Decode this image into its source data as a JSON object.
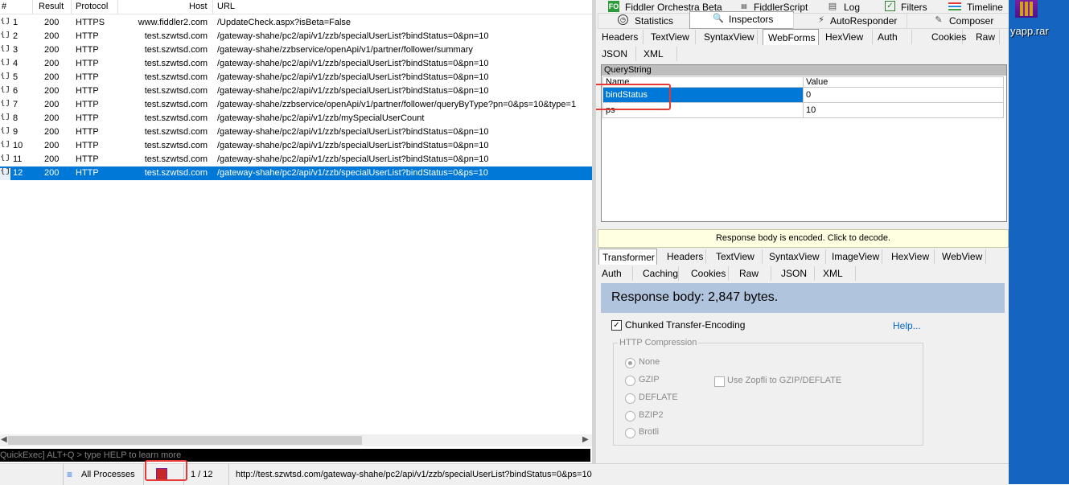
{
  "sessions": {
    "columns": {
      "num": "#",
      "result": "Result",
      "protocol": "Protocol",
      "host": "Host",
      "url": "URL"
    },
    "rows": [
      {
        "num": "1",
        "result": "200",
        "protocol": "HTTPS",
        "host": "www.fiddler2.com",
        "url": "/UpdateCheck.aspx?isBeta=False"
      },
      {
        "num": "2",
        "result": "200",
        "protocol": "HTTP",
        "host": "test.szwtsd.com",
        "url": "/gateway-shahe/pc2/api/v1/zzb/specialUserList?bindStatus=0&pn=10"
      },
      {
        "num": "3",
        "result": "200",
        "protocol": "HTTP",
        "host": "test.szwtsd.com",
        "url": "/gateway-shahe/zzbservice/openApi/v1/partner/follower/summary"
      },
      {
        "num": "4",
        "result": "200",
        "protocol": "HTTP",
        "host": "test.szwtsd.com",
        "url": "/gateway-shahe/pc2/api/v1/zzb/specialUserList?bindStatus=0&pn=10"
      },
      {
        "num": "5",
        "result": "200",
        "protocol": "HTTP",
        "host": "test.szwtsd.com",
        "url": "/gateway-shahe/pc2/api/v1/zzb/specialUserList?bindStatus=0&pn=10"
      },
      {
        "num": "6",
        "result": "200",
        "protocol": "HTTP",
        "host": "test.szwtsd.com",
        "url": "/gateway-shahe/pc2/api/v1/zzb/specialUserList?bindStatus=0&pn=10"
      },
      {
        "num": "7",
        "result": "200",
        "protocol": "HTTP",
        "host": "test.szwtsd.com",
        "url": "/gateway-shahe/zzbservice/openApi/v1/partner/follower/queryByType?pn=0&ps=10&type=1"
      },
      {
        "num": "8",
        "result": "200",
        "protocol": "HTTP",
        "host": "test.szwtsd.com",
        "url": "/gateway-shahe/pc2/api/v1/zzb/mySpecialUserCount"
      },
      {
        "num": "9",
        "result": "200",
        "protocol": "HTTP",
        "host": "test.szwtsd.com",
        "url": "/gateway-shahe/pc2/api/v1/zzb/specialUserList?bindStatus=0&pn=10"
      },
      {
        "num": "10",
        "result": "200",
        "protocol": "HTTP",
        "host": "test.szwtsd.com",
        "url": "/gateway-shahe/pc2/api/v1/zzb/specialUserList?bindStatus=0&pn=10"
      },
      {
        "num": "11",
        "result": "200",
        "protocol": "HTTP",
        "host": "test.szwtsd.com",
        "url": "/gateway-shahe/pc2/api/v1/zzb/specialUserList?bindStatus=0&pn=10"
      },
      {
        "num": "12",
        "result": "200",
        "protocol": "HTTP",
        "host": "test.szwtsd.com",
        "url": "/gateway-shahe/pc2/api/v1/zzb/specialUserList?bindStatus=0&ps=10",
        "selected": true
      }
    ],
    "row_icon_text": "{js}\nJSON"
  },
  "quickexec": {
    "placeholder": "QuickExec] ALT+Q > type HELP to learn more"
  },
  "top_tabs_row1": {
    "orchestra": "Fiddler Orchestra Beta",
    "orchestra_badge": "FO",
    "fiddlerscript": "FiddlerScript",
    "log": "Log",
    "filters": "Filters",
    "timeline": "Timeline"
  },
  "top_tabs_row2": {
    "statistics": "Statistics",
    "inspectors": "Inspectors",
    "autoresponder": "AutoResponder",
    "composer": "Composer"
  },
  "request_tabs": {
    "headers": "Headers",
    "textview": "TextView",
    "syntaxview": "SyntaxView",
    "webforms": "WebForms",
    "hexview": "HexView",
    "auth": "Auth",
    "cookies": "Cookies",
    "raw": "Raw",
    "json": "JSON",
    "xml": "XML"
  },
  "querystring": {
    "title": "QueryString",
    "col_name": "Name",
    "col_value": "Value",
    "rows": [
      {
        "name": "bindStatus",
        "value": "0"
      },
      {
        "name": "ps",
        "value": "10"
      }
    ]
  },
  "encoded_notice": "Response body is encoded. Click to decode.",
  "response_tabs": {
    "transformer": "Transformer",
    "headers": "Headers",
    "textview": "TextView",
    "syntaxview": "SyntaxView",
    "imageview": "ImageView",
    "hexview": "HexView",
    "webview": "WebView",
    "auth": "Auth",
    "caching": "Caching",
    "cookies": "Cookies",
    "raw": "Raw",
    "json": "JSON",
    "xml": "XML"
  },
  "transformer": {
    "response_body": "Response body: 2,847 bytes.",
    "chunked_label": "Chunked Transfer-Encoding",
    "chunked_checked": true,
    "help_link": "Help...",
    "compression_legend": "HTTP Compression",
    "options": [
      "None",
      "GZIP",
      "DEFLATE",
      "BZIP2",
      "Brotli"
    ],
    "selected_option": "None",
    "zopfli_label": "Use Zopfli to GZIP/DEFLATE"
  },
  "statusbar": {
    "processes": "All Processes",
    "count": "1 / 12",
    "url": "http://test.szwtsd.com/gateway-shahe/pc2/api/v1/zzb/specialUserList?bindStatus=0&ps=10"
  },
  "desktop": {
    "file_label": "yapp.rar"
  },
  "colors": {
    "selection": "#0078d7",
    "highlight_box": "#e53935",
    "banner": "#b0c4de",
    "desktop": "#1565c0"
  }
}
